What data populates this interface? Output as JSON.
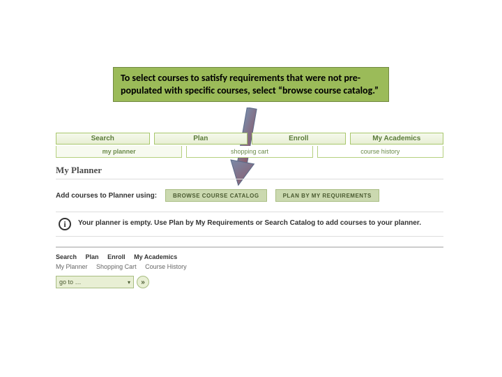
{
  "callout": {
    "text": "To select courses to satisfy requirements that were not pre-populated with specific courses, select “browse course catalog.”"
  },
  "tabs": {
    "main": [
      "Search",
      "Plan",
      "Enroll",
      "My Academics"
    ],
    "sub": [
      "my planner",
      "shopping cart",
      "course history"
    ]
  },
  "section": {
    "title": "My Planner"
  },
  "addRow": {
    "label": "Add courses to Planner using:",
    "browseBtn": "BROWSE COURSE CATALOG",
    "planBtn": "PLAN BY MY REQUIREMENTS"
  },
  "info": {
    "icon": "i",
    "text": "Your planner is empty. Use Plan by My Requirements or Search Catalog to add courses to your planner."
  },
  "breadcrumb1": [
    "Search",
    "Plan",
    "Enroll",
    "My Academics"
  ],
  "breadcrumb2": [
    "My Planner",
    "Shopping Cart",
    "Course History"
  ],
  "goto": {
    "label": "go to …",
    "arrow": "»"
  }
}
